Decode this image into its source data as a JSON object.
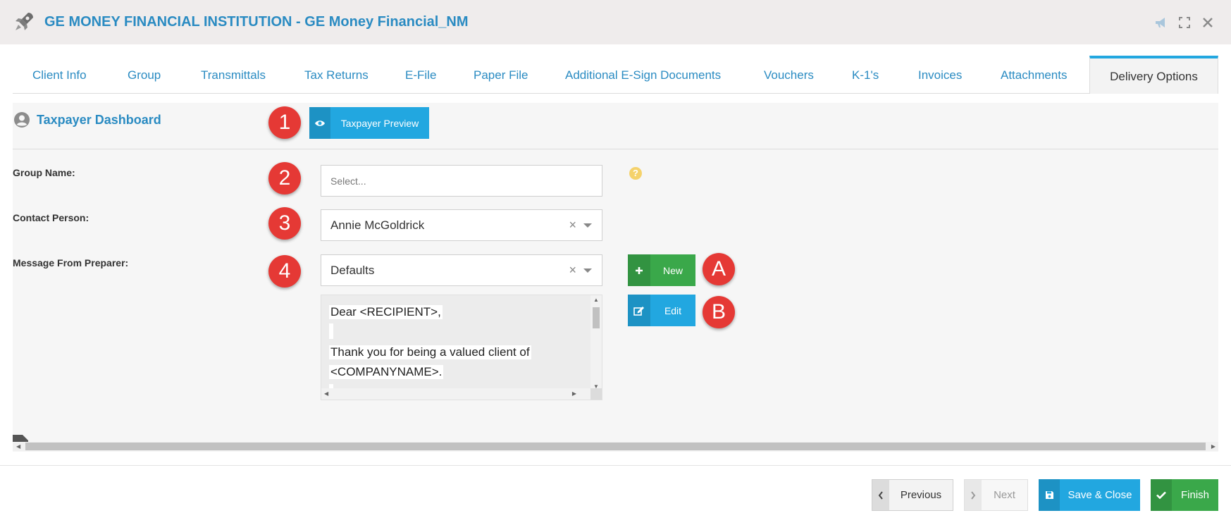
{
  "header": {
    "title": "GE MONEY FINANCIAL INSTITUTION - GE Money Financial_NM"
  },
  "tabs": [
    {
      "label": "Client Info"
    },
    {
      "label": "Group"
    },
    {
      "label": "Transmittals"
    },
    {
      "label": "Tax Returns"
    },
    {
      "label": "E-File"
    },
    {
      "label": "Paper File"
    },
    {
      "label": "Additional E-Sign Documents"
    },
    {
      "label": "Vouchers"
    },
    {
      "label": "K-1's"
    },
    {
      "label": "Invoices"
    },
    {
      "label": "Attachments"
    },
    {
      "label": "Delivery Options"
    }
  ],
  "dashboard": {
    "title": "Taxpayer Dashboard",
    "preview_label": "Taxpayer Preview"
  },
  "badges": {
    "b1": "1",
    "b2": "2",
    "b3": "3",
    "b4": "4",
    "bA": "A",
    "bB": "B"
  },
  "form": {
    "group_name_label": "Group Name:",
    "group_name_placeholder": "Select...",
    "help_glyph": "?",
    "contact_label": "Contact Person:",
    "contact_value": "Annie McGoldrick",
    "message_label": "Message From Preparer:",
    "message_value": "Defaults",
    "clear_glyph": "×",
    "new_label": "New",
    "edit_label": "Edit",
    "message_lines": [
      "Dear <RECIPIENT>,",
      "",
      "Thank you for being a valued client of",
      "<COMPANYNAME>."
    ]
  },
  "footer": {
    "previous_label": "Previous",
    "next_label": "Next",
    "save_close_label": "Save & Close",
    "finish_label": "Finish"
  },
  "colors": {
    "title_blue": "#2a8bc2",
    "accent_blue": "#22a7e0",
    "green": "#3aa84a",
    "badge_red": "#e53935"
  }
}
